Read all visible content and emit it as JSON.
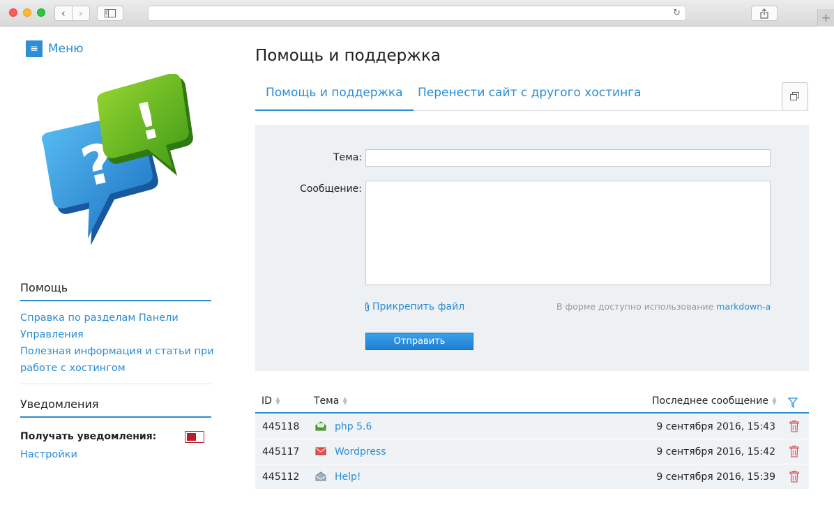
{
  "sidebar": {
    "menu_label": "Меню",
    "help_title": "Помощь",
    "help_links": [
      "Справка по разделам Панели",
      "Управления",
      "Полезная информация и статьи при",
      "работе с хостингом"
    ],
    "notifications_title": "Уведомления",
    "receive_label": "Получать уведомления:",
    "settings_link": "Настройки"
  },
  "main": {
    "page_title": "Помощь и поддержка",
    "tabs": [
      {
        "label": "Помощь и поддержка",
        "active": true
      },
      {
        "label": "Перенести сайт с другого хостинга",
        "active": false
      }
    ],
    "form": {
      "subject_label": "Тема:",
      "subject_value": "",
      "message_label": "Сообщение:",
      "message_value": "",
      "attach_label": "Прикрепить файл",
      "markdown_note": "В форме доступно использование ",
      "markdown_link": "markdown-a",
      "submit_label": "Отправить"
    },
    "table": {
      "headers": {
        "id": "ID",
        "subject": "Тема",
        "last_message": "Последнее сообщение"
      },
      "rows": [
        {
          "id": "445118",
          "subject": "php 5.6",
          "date": "9 сентября 2016, 15:43",
          "icon": "open-envelope-green-icon"
        },
        {
          "id": "445117",
          "subject": "Wordpress",
          "date": "9 сентября 2016, 15:42",
          "icon": "closed-envelope-red-icon"
        },
        {
          "id": "445112",
          "subject": "Help!",
          "date": "9 сентября 2016, 15:39",
          "icon": "open-envelope-gray-icon"
        }
      ]
    }
  },
  "colors": {
    "accent": "#2a8dd4",
    "toggle": "#b7202a",
    "panel_bg": "#edf1f4"
  }
}
